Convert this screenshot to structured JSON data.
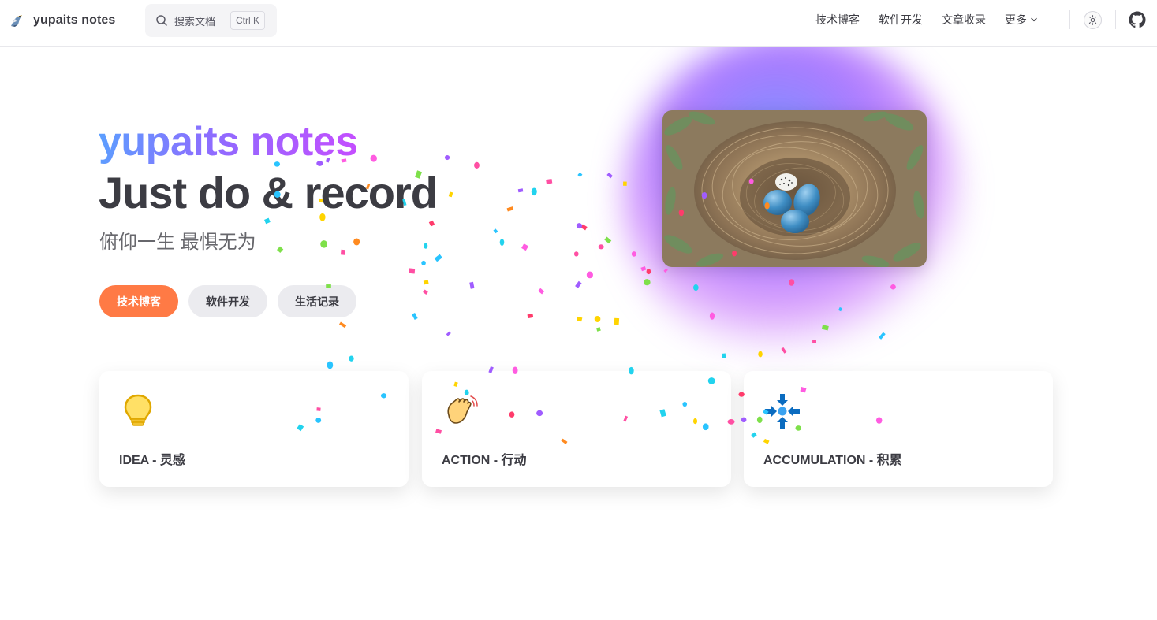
{
  "nav": {
    "title": "yupaits notes",
    "search_label": "搜索文档",
    "search_kbd": "Ctrl K",
    "links": [
      {
        "label": "技术博客"
      },
      {
        "label": "软件开发"
      },
      {
        "label": "文章收录"
      },
      {
        "label": "更多"
      }
    ]
  },
  "hero": {
    "name": "yupaits notes",
    "text": "Just do & record",
    "tagline": "俯仰一生 最惧无为",
    "actions": [
      {
        "label": "技术博客",
        "theme": "brand"
      },
      {
        "label": "软件开发",
        "theme": "alt"
      },
      {
        "label": "生活记录",
        "theme": "alt"
      }
    ],
    "image_alt": "bird nest with eggs"
  },
  "features": [
    {
      "icon": "lightbulb-icon",
      "title": "IDEA - 灵感"
    },
    {
      "icon": "waving-hand-icon",
      "title": "ACTION - 行动"
    },
    {
      "icon": "arrows-converge-icon",
      "title": "ACCUMULATION - 积累"
    }
  ],
  "colors": {
    "brand": "#ff7a45",
    "text": "#3c3c43",
    "gradient_start": "#5aa0ff",
    "gradient_end": "#c64dff"
  }
}
